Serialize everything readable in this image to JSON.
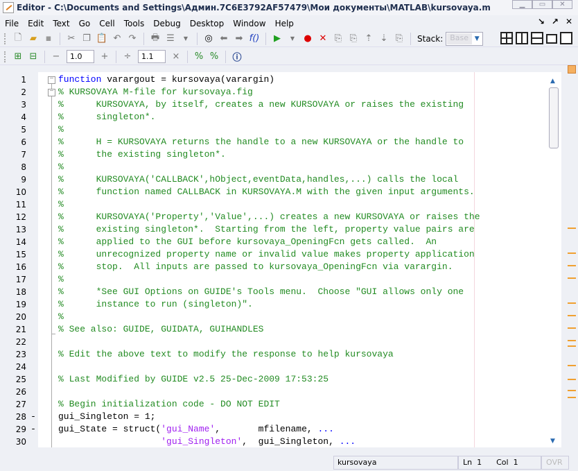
{
  "window": {
    "title": "Editor - C:\\Documents and Settings\\Админ.7C6E3792AF57479\\Мои документы\\MATLAB\\kursovaya.m"
  },
  "menu": [
    "File",
    "Edit",
    "Text",
    "Go",
    "Cell",
    "Tools",
    "Debug",
    "Desktop",
    "Window",
    "Help"
  ],
  "toolbar": {
    "stack_label": "Stack:",
    "stack_value": "Base"
  },
  "cell_toolbar": {
    "decrement": "−",
    "increment_value": "1.0",
    "increment": "+",
    "divide": "÷",
    "scale_value": "1.1",
    "times": "×"
  },
  "editor": {
    "lines": [
      {
        "n": "1",
        "fold": true,
        "segs": [
          {
            "c": "kw",
            "t": "function"
          },
          {
            "c": "",
            "t": " varargout = kursovaya(varargin)"
          }
        ]
      },
      {
        "n": "2",
        "fold": true,
        "segs": [
          {
            "c": "cm",
            "t": "% KURSOVAYA M-file for kursovaya.fig"
          }
        ]
      },
      {
        "n": "3",
        "segs": [
          {
            "c": "cm",
            "t": "%      KURSOVAYA, by itself, creates a new KURSOVAYA or raises the existing"
          }
        ]
      },
      {
        "n": "4",
        "segs": [
          {
            "c": "cm",
            "t": "%      singleton*."
          }
        ]
      },
      {
        "n": "5",
        "segs": [
          {
            "c": "cm",
            "t": "%"
          }
        ]
      },
      {
        "n": "6",
        "segs": [
          {
            "c": "cm",
            "t": "%      H = KURSOVAYA returns the handle to a new KURSOVAYA or the handle to"
          }
        ]
      },
      {
        "n": "7",
        "segs": [
          {
            "c": "cm",
            "t": "%      the existing singleton*."
          }
        ]
      },
      {
        "n": "8",
        "segs": [
          {
            "c": "cm",
            "t": "%"
          }
        ]
      },
      {
        "n": "9",
        "segs": [
          {
            "c": "cm",
            "t": "%      KURSOVAYA('CALLBACK',hObject,eventData,handles,...) calls the local"
          }
        ]
      },
      {
        "n": "10",
        "segs": [
          {
            "c": "cm",
            "t": "%      function named CALLBACK in KURSOVAYA.M with the given input arguments."
          }
        ]
      },
      {
        "n": "11",
        "segs": [
          {
            "c": "cm",
            "t": "%"
          }
        ]
      },
      {
        "n": "12",
        "segs": [
          {
            "c": "cm",
            "t": "%      KURSOVAYA('Property','Value',...) creates a new KURSOVAYA or raises the"
          }
        ]
      },
      {
        "n": "13",
        "segs": [
          {
            "c": "cm",
            "t": "%      existing singleton*.  Starting from the left, property value pairs are"
          }
        ]
      },
      {
        "n": "14",
        "segs": [
          {
            "c": "cm",
            "t": "%      applied to the GUI before kursovaya_OpeningFcn gets called.  An"
          }
        ]
      },
      {
        "n": "15",
        "segs": [
          {
            "c": "cm",
            "t": "%      unrecognized property name or invalid value makes property application"
          }
        ]
      },
      {
        "n": "16",
        "segs": [
          {
            "c": "cm",
            "t": "%      stop.  All inputs are passed to kursovaya_OpeningFcn via varargin."
          }
        ]
      },
      {
        "n": "17",
        "segs": [
          {
            "c": "cm",
            "t": "%"
          }
        ]
      },
      {
        "n": "18",
        "segs": [
          {
            "c": "cm",
            "t": "%      *See GUI Options on GUIDE's Tools menu.  Choose \"GUI allows only one"
          }
        ]
      },
      {
        "n": "19",
        "segs": [
          {
            "c": "cm",
            "t": "%      instance to run (singleton)\"."
          }
        ]
      },
      {
        "n": "20",
        "segs": [
          {
            "c": "cm",
            "t": "%"
          }
        ]
      },
      {
        "n": "21",
        "segs": [
          {
            "c": "cm",
            "t": "% See also: GUIDE, GUIDATA, GUIHANDLES"
          }
        ]
      },
      {
        "n": "22",
        "segs": []
      },
      {
        "n": "23",
        "segs": [
          {
            "c": "cm",
            "t": "% Edit the above text to modify the response to help kursovaya"
          }
        ]
      },
      {
        "n": "24",
        "segs": []
      },
      {
        "n": "25",
        "segs": [
          {
            "c": "cm",
            "t": "% Last Modified by GUIDE v2.5 25-Dec-2009 17:53:25"
          }
        ]
      },
      {
        "n": "26",
        "segs": []
      },
      {
        "n": "27",
        "segs": [
          {
            "c": "cm",
            "t": "% Begin initialization code - DO NOT EDIT"
          }
        ]
      },
      {
        "n": "28",
        "bp": "-",
        "segs": [
          {
            "c": "",
            "t": "gui_Singleton = 1;"
          }
        ]
      },
      {
        "n": "29",
        "bp": "-",
        "segs": [
          {
            "c": "",
            "t": "gui_State = struct("
          },
          {
            "c": "str",
            "t": "'gui_Name'"
          },
          {
            "c": "",
            "t": ",       mfilename, "
          },
          {
            "c": "ctn",
            "t": "..."
          }
        ]
      },
      {
        "n": "30",
        "segs": [
          {
            "c": "",
            "t": "                   "
          },
          {
            "c": "str",
            "t": "'gui_Singleton'"
          },
          {
            "c": "",
            "t": ",  gui_Singleton, "
          },
          {
            "c": "ctn",
            "t": "..."
          }
        ]
      }
    ]
  },
  "status": {
    "function_name": "kursovaya",
    "ln_label": "Ln",
    "ln": "1",
    "col_label": "Col",
    "col": "1",
    "ovr": "OVR"
  }
}
